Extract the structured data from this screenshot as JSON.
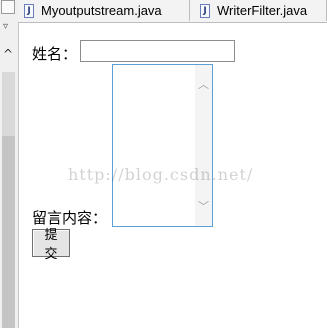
{
  "tabs": [
    {
      "label": "Myoutputstream.java",
      "icon": "java-file-icon"
    },
    {
      "label": "WriterFilter.java",
      "icon": "java-file-icon"
    }
  ],
  "form": {
    "name_label": "姓名：",
    "name_value": "",
    "message_label": "留言内容：",
    "message_value": "",
    "submit_label": "提交"
  },
  "watermark": "http://blog.csdn.net/",
  "icons": {
    "file_badge": "J",
    "chevron_down": "▿",
    "chevron_up": "^",
    "scroll_up": "︿",
    "scroll_down": "﹀"
  }
}
